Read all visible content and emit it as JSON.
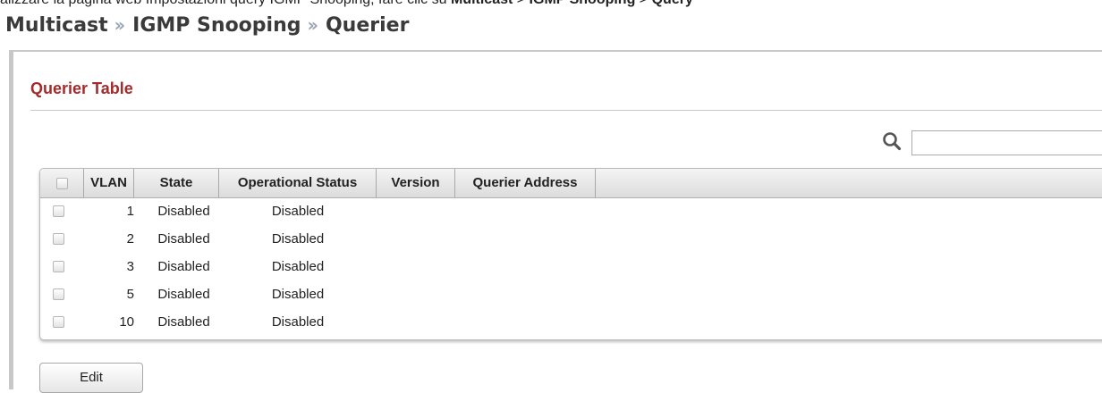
{
  "doc_text": {
    "prefix": "alizzare la pagina web Impostazioni query IGMP Snooping, fare clic su ",
    "bold1": "Multicast",
    "sep": " > ",
    "bold2": "IGMP Snooping",
    "bold3": "Query"
  },
  "breadcrumb": {
    "items": [
      "Multicast",
      "IGMP Snooping",
      "Querier"
    ],
    "separator": "››"
  },
  "section": {
    "title": "Querier Table"
  },
  "search": {
    "value": "",
    "placeholder": "",
    "icon": "search-icon"
  },
  "table": {
    "columns": [
      "",
      "VLAN",
      "State",
      "Operational Status",
      "Version",
      "Querier Address"
    ],
    "rows": [
      {
        "vlan": "1",
        "state": "Disabled",
        "operational_status": "Disabled",
        "version": "",
        "querier_address": ""
      },
      {
        "vlan": "2",
        "state": "Disabled",
        "operational_status": "Disabled",
        "version": "",
        "querier_address": ""
      },
      {
        "vlan": "3",
        "state": "Disabled",
        "operational_status": "Disabled",
        "version": "",
        "querier_address": ""
      },
      {
        "vlan": "5",
        "state": "Disabled",
        "operational_status": "Disabled",
        "version": "",
        "querier_address": ""
      },
      {
        "vlan": "10",
        "state": "Disabled",
        "operational_status": "Disabled",
        "version": "",
        "querier_address": ""
      }
    ]
  },
  "buttons": {
    "edit_label": "Edit"
  },
  "colors": {
    "section_title": "#a52a2a",
    "breadcrumb_separator": "#9aa5b5",
    "panel_border": "#c8c8c8"
  }
}
